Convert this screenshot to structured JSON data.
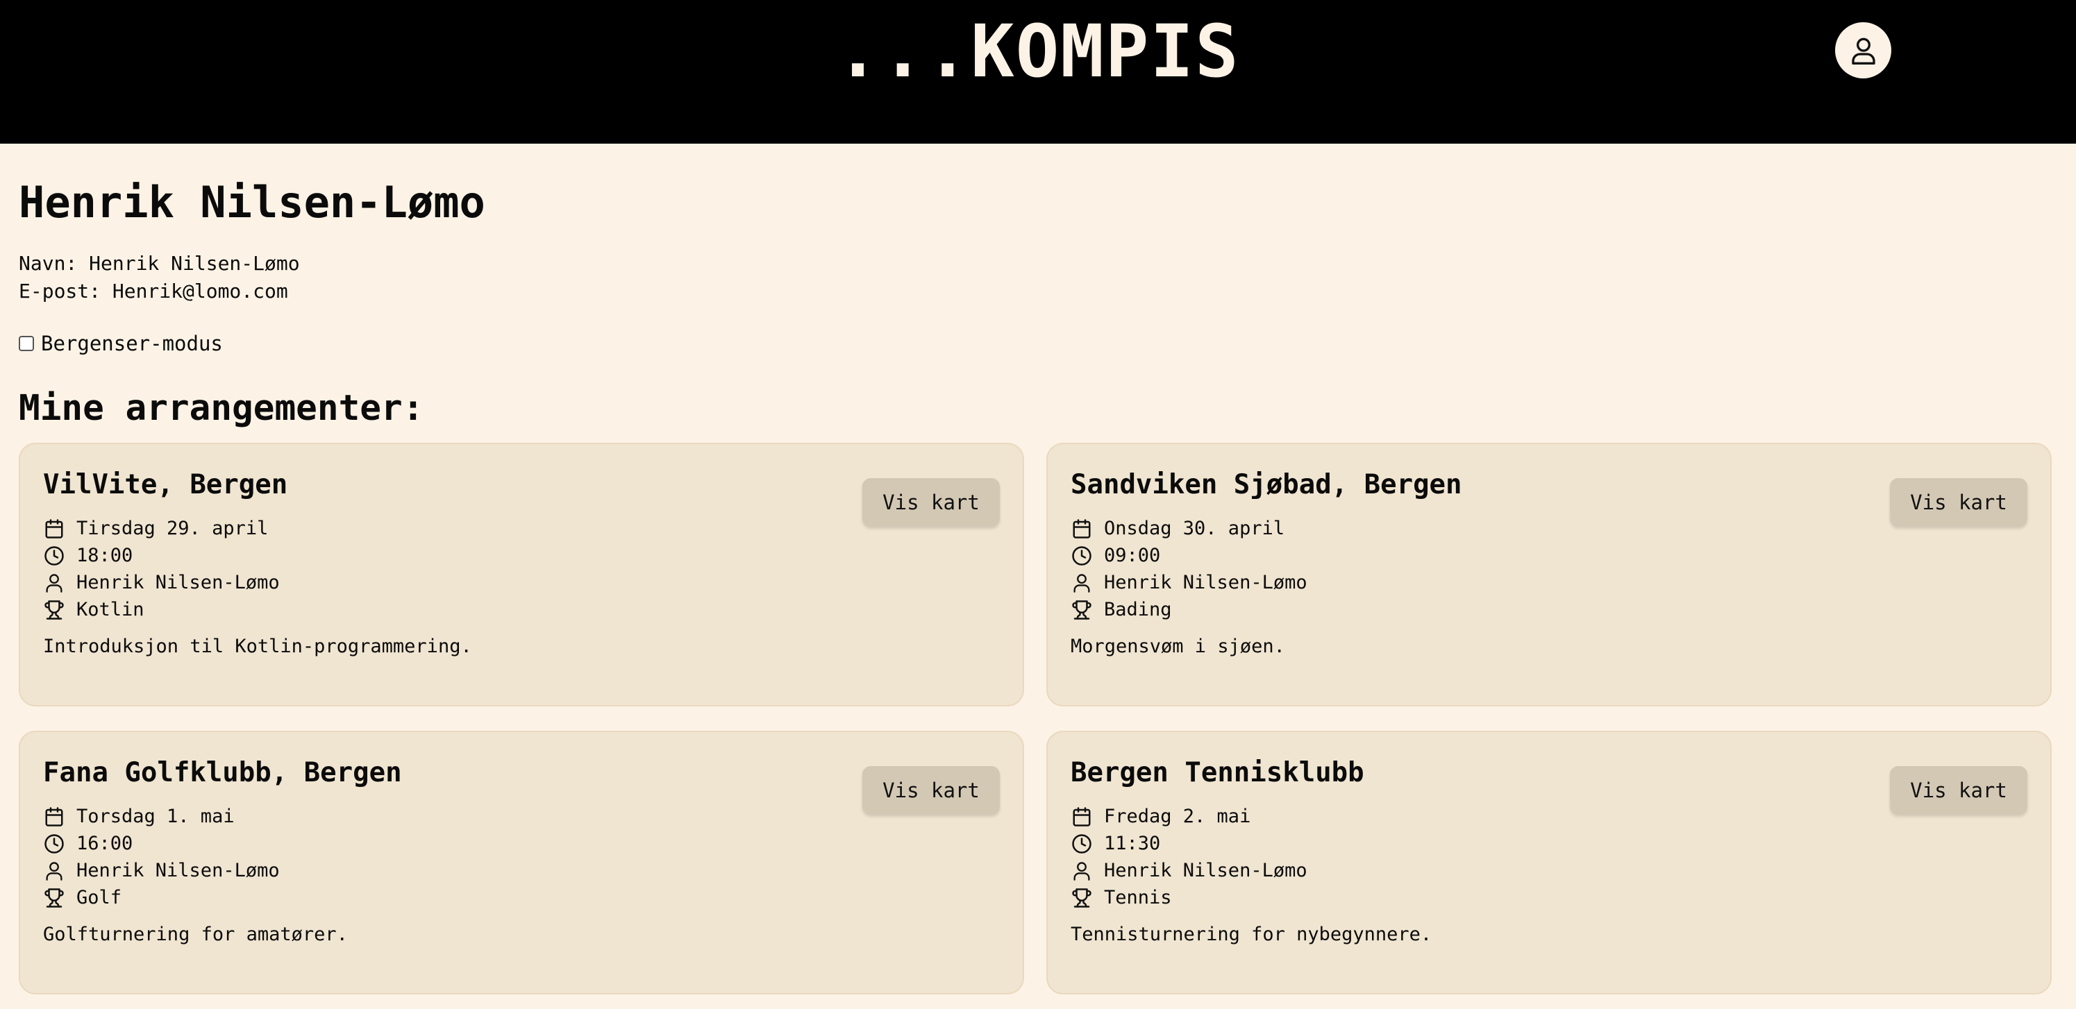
{
  "header": {
    "brand": "...KOMPIS"
  },
  "profile": {
    "title": "Henrik Nilsen-Lømo",
    "name_line": "Navn: Henrik Nilsen-Lømo",
    "email_line": "E-post: Henrik@lomo.com",
    "checkbox_label": "Bergenser-modus",
    "checkbox_checked": false
  },
  "section_title": "Mine arrangementer:",
  "events": [
    {
      "title": "VilVite, Bergen",
      "date": "Tirsdag 29. april",
      "time": "18:00",
      "host": "Henrik Nilsen-Lømo",
      "category": "Kotlin",
      "description": "Introduksjon til Kotlin-programmering.",
      "button": "Vis kart"
    },
    {
      "title": "Sandviken Sjøbad, Bergen",
      "date": "Onsdag 30. april",
      "time": "09:00",
      "host": "Henrik Nilsen-Lømo",
      "category": "Bading",
      "description": "Morgensvøm i sjøen.",
      "button": "Vis kart"
    },
    {
      "title": "Fana Golfklubb, Bergen",
      "date": "Torsdag 1. mai",
      "time": "16:00",
      "host": "Henrik Nilsen-Lømo",
      "category": "Golf",
      "description": "Golfturnering for amatører.",
      "button": "Vis kart"
    },
    {
      "title": "Bergen Tennisklubb",
      "date": "Fredag 2. mai",
      "time": "11:30",
      "host": "Henrik Nilsen-Lømo",
      "category": "Tennis",
      "description": "Tennisturnering for nybegynnere.",
      "button": "Vis kart"
    }
  ],
  "icons": {
    "profile": "user-icon",
    "date": "calendar-icon",
    "time": "clock-icon",
    "host": "user-icon",
    "category": "trophy-icon"
  },
  "colors": {
    "background": "#FCF3E6",
    "header": "#000000",
    "card": "#F0E5D1",
    "button": "#D3C8B4"
  }
}
